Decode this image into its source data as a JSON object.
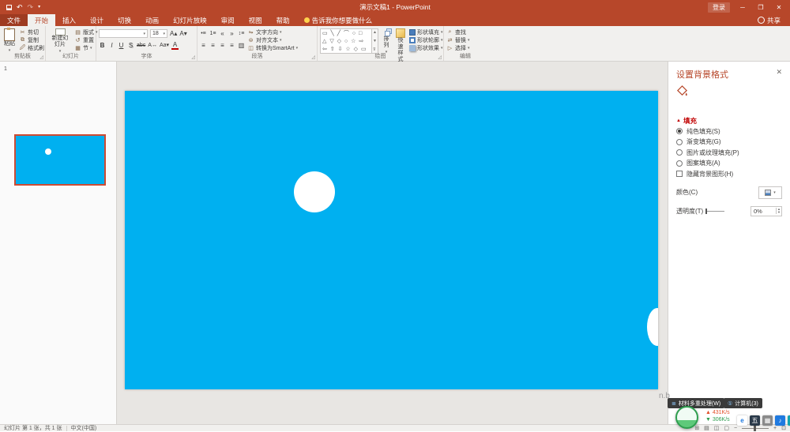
{
  "titlebar": {
    "title": "演示文稿1 - PowerPoint",
    "sign_in": "登录"
  },
  "tabs": {
    "items": [
      "文件",
      "开始",
      "插入",
      "设计",
      "切换",
      "动画",
      "幻灯片放映",
      "审阅",
      "视图",
      "帮助"
    ],
    "active": "开始",
    "tell_me": "告诉我你想要做什么",
    "share": "共享"
  },
  "ribbon": {
    "clipboard": {
      "group": "剪贴板",
      "paste": "粘贴",
      "cut": "剪切",
      "copy": "复制",
      "format_painter": "格式刷"
    },
    "slides": {
      "group": "幻灯片",
      "new_slide": "新建幻灯片",
      "layout": "版式",
      "reset": "重置",
      "section": "节"
    },
    "font": {
      "group": "字体",
      "size": "18"
    },
    "paragraph": {
      "group": "段落",
      "text_direction": "文字方向",
      "align_text": "对齐文本",
      "smartart": "转换为SmartArt"
    },
    "drawing": {
      "group": "绘图",
      "arrange": "排列",
      "quick_styles": "快速样式",
      "shape_fill": "形状填充",
      "shape_outline": "形状轮廓",
      "shape_effects": "形状效果"
    },
    "editing": {
      "group": "编辑",
      "find": "查找",
      "replace": "替换",
      "select": "选择"
    }
  },
  "slides_panel": {
    "slide_number": "1"
  },
  "format_pane": {
    "title": "设置背景格式",
    "fill_section": "填充",
    "solid_fill": "纯色填充(S)",
    "gradient_fill": "渐变填充(G)",
    "picture_fill": "图片或纹理填充(P)",
    "pattern_fill": "图案填充(A)",
    "hide_bg": "隐藏背景图形(H)",
    "color_label": "颜色(C)",
    "transparency_label": "透明度(T)",
    "transparency_value": "0%"
  },
  "statusbar": {
    "slide_indicator": "幻灯片 第 1 张，共 1 张",
    "language": "中文(中国)"
  },
  "overlay": {
    "watermark": "n.b",
    "badge_left": "材料多重处理(W)",
    "badge_right": "计算机(3)",
    "speed_up": "431K/s",
    "speed_down": "306K/s"
  },
  "colors": {
    "accent": "#B7472A",
    "slide_fill": "#00B0F0"
  }
}
